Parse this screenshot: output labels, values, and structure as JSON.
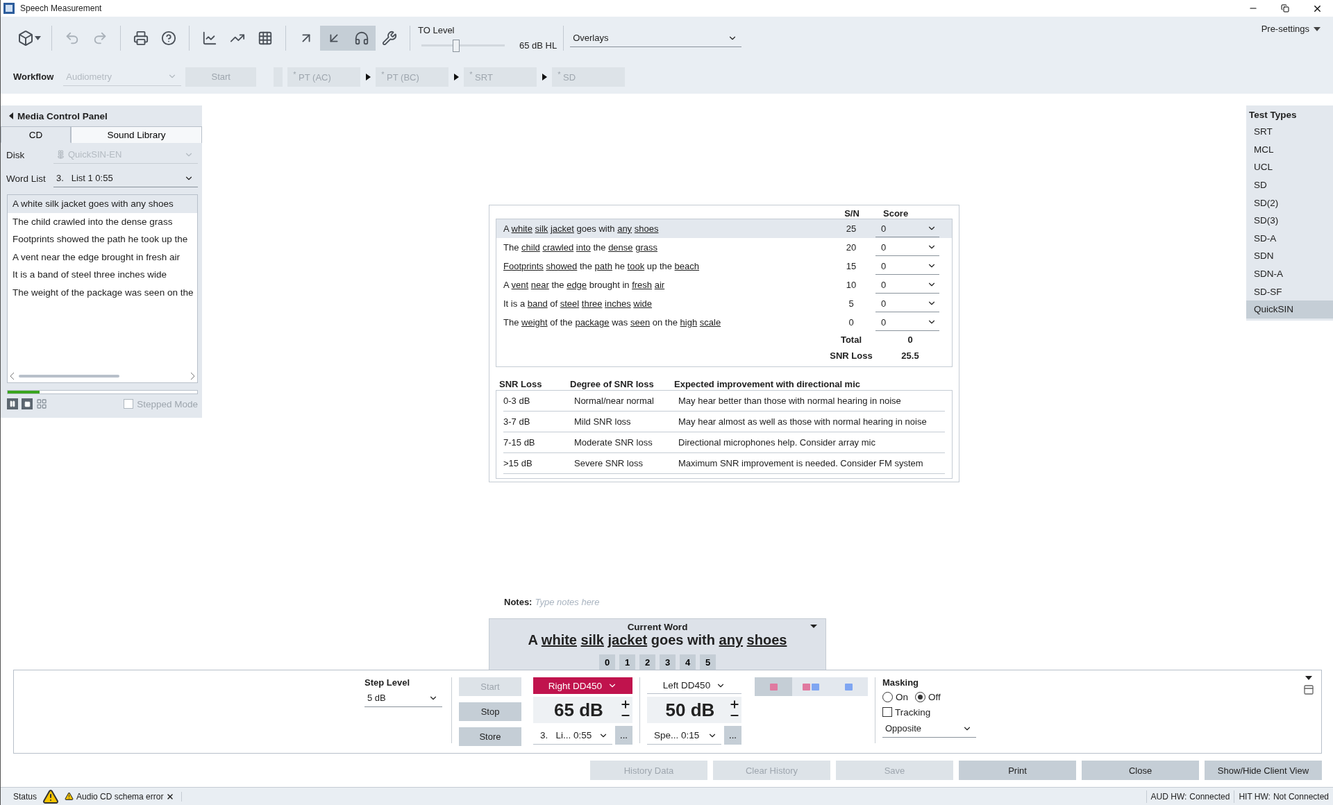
{
  "window": {
    "title": "Speech Measurement"
  },
  "toolbar": {
    "groups": [
      {
        "tools": [
          {
            "kind": "cube_menu",
            "disabled": false,
            "selected": false
          }
        ]
      },
      {
        "tools": [
          {
            "kind": "undo",
            "disabled": true,
            "selected": false
          },
          {
            "kind": "redo",
            "disabled": true,
            "selected": false
          }
        ]
      },
      {
        "tools": [
          {
            "kind": "print",
            "disabled": false,
            "selected": false
          },
          {
            "kind": "help",
            "disabled": false,
            "selected": false
          }
        ]
      },
      {
        "tools": [
          {
            "kind": "audiogram",
            "disabled": false,
            "selected": false
          },
          {
            "kind": "overlay_chart",
            "disabled": false,
            "selected": false
          },
          {
            "kind": "grid_chart",
            "disabled": false,
            "selected": false
          }
        ]
      },
      {
        "tools": [
          {
            "kind": "arrow_out",
            "disabled": false,
            "selected": false
          },
          {
            "kind": "arrow_in",
            "disabled": false,
            "selected": true
          },
          {
            "kind": "headphones",
            "disabled": false,
            "selected": true
          },
          {
            "kind": "wrench",
            "disabled": false,
            "selected": false
          }
        ]
      }
    ],
    "to_level": {
      "label": "TO Level",
      "level": 0.42,
      "reading": "65 dB HL"
    },
    "overlays": {
      "value": "Overlays"
    },
    "presettings": "Pre-settings"
  },
  "workflow": {
    "label": "Workflow",
    "dropdown": {
      "value": "Audiometry",
      "disabled": true
    },
    "start": {
      "label": "Start",
      "disabled": true
    },
    "steps": [
      {
        "label": "$^{*}$ PT (AC)"
      },
      {
        "label": "$^{*}$ PT (BC)"
      },
      {
        "label": "$^{*}$ SRT"
      },
      {
        "label": "$^{*}$ SD"
      }
    ]
  },
  "media_panel": {
    "title": "Media Control Panel",
    "tabs": [
      {
        "label": "CD",
        "selected": true
      },
      {
        "label": "Sound Library",
        "selected": false
      }
    ],
    "disk": {
      "label": "Disk",
      "value": "QuickSIN-EN",
      "disabled": true
    },
    "word_list": {
      "label": "Word List",
      "value": "3.   List 1 0:55"
    },
    "items": [
      {
        "text": "A white silk jacket goes with any shoes",
        "selected": true
      },
      {
        "text": "The child crawled into the dense grass",
        "selected": false
      },
      {
        "text": "Footprints showed the path he took up the",
        "selected": false
      },
      {
        "text": "A vent near the edge brought in fresh air",
        "selected": false
      },
      {
        "text": "It is a band of steel three inches wide",
        "selected": false
      },
      {
        "text": "The weight of the package was seen on the",
        "selected": false
      }
    ],
    "progress": {
      "level": 0.17
    },
    "stepped_mode": {
      "label": "Stepped Mode",
      "checked": false,
      "disabled": true
    }
  },
  "results": {
    "columns": [
      "S/N",
      "Score"
    ],
    "rows": [
      {
        "selected": true,
        "sn": "25",
        "score": "0",
        "words": [
          {
            "word": "A",
            "underlined": false
          },
          {
            "word": "white",
            "underlined": true
          },
          {
            "word": "silk",
            "underlined": true
          },
          {
            "word": "jacket",
            "underlined": true
          },
          {
            "word": "goes",
            "underlined": false
          },
          {
            "word": "with",
            "underlined": false
          },
          {
            "word": "any",
            "underlined": true
          },
          {
            "word": "shoes",
            "underlined": true
          }
        ]
      },
      {
        "selected": false,
        "sn": "20",
        "score": "0",
        "words": [
          {
            "word": "The",
            "underlined": false
          },
          {
            "word": "child",
            "underlined": true
          },
          {
            "word": "crawled",
            "underlined": true
          },
          {
            "word": "into",
            "underlined": true
          },
          {
            "word": "the",
            "underlined": false
          },
          {
            "word": "dense",
            "underlined": true
          },
          {
            "word": "grass",
            "underlined": true
          }
        ]
      },
      {
        "selected": false,
        "sn": "15",
        "score": "0",
        "words": [
          {
            "word": "Footprints",
            "underlined": true
          },
          {
            "word": "showed",
            "underlined": true
          },
          {
            "word": "the",
            "underlined": false
          },
          {
            "word": "path",
            "underlined": true
          },
          {
            "word": "he",
            "underlined": false
          },
          {
            "word": "took",
            "underlined": true
          },
          {
            "word": "up",
            "underlined": false
          },
          {
            "word": "the",
            "underlined": false
          },
          {
            "word": "beach",
            "underlined": true
          }
        ]
      },
      {
        "selected": false,
        "sn": "10",
        "score": "0",
        "words": [
          {
            "word": "A",
            "underlined": false
          },
          {
            "word": "vent",
            "underlined": true
          },
          {
            "word": "near",
            "underlined": true
          },
          {
            "word": "the",
            "underlined": false
          },
          {
            "word": "edge",
            "underlined": true
          },
          {
            "word": "brought",
            "underlined": false
          },
          {
            "word": "in",
            "underlined": false
          },
          {
            "word": "fresh",
            "underlined": true
          },
          {
            "word": "air",
            "underlined": true
          }
        ]
      },
      {
        "selected": false,
        "sn": "5",
        "score": "0",
        "words": [
          {
            "word": "It",
            "underlined": false
          },
          {
            "word": "is",
            "underlined": false
          },
          {
            "word": "a",
            "underlined": false
          },
          {
            "word": "band",
            "underlined": true
          },
          {
            "word": "of",
            "underlined": false
          },
          {
            "word": "steel",
            "underlined": true
          },
          {
            "word": "three",
            "underlined": true
          },
          {
            "word": "inches",
            "underlined": true
          },
          {
            "word": "wide",
            "underlined": true
          }
        ]
      },
      {
        "selected": false,
        "sn": "0",
        "score": "0",
        "words": [
          {
            "word": "The",
            "underlined": false
          },
          {
            "word": "weight",
            "underlined": true
          },
          {
            "word": "of",
            "underlined": false
          },
          {
            "word": "the",
            "underlined": false
          },
          {
            "word": "package",
            "underlined": true
          },
          {
            "word": "was",
            "underlined": false
          },
          {
            "word": "seen",
            "underlined": true
          },
          {
            "word": "on",
            "underlined": false
          },
          {
            "word": "the",
            "underlined": false
          },
          {
            "word": "high",
            "underlined": true
          },
          {
            "word": "scale",
            "underlined": true
          }
        ]
      }
    ],
    "total": {
      "label": "Total",
      "value": "0"
    },
    "snr_loss": {
      "label": "SNR Loss",
      "value": "25.5"
    }
  },
  "snr_table": {
    "columns": [
      "SNR Loss",
      "Degree of SNR loss",
      "Expected improvement with directional mic"
    ],
    "rows": [
      [
        "0-3 dB",
        "Normal/near normal",
        "May hear better than those with normal hearing in noise"
      ],
      [
        "3-7 dB",
        "Mild SNR loss",
        "May hear almost as well as those with normal hearing in noise"
      ],
      [
        "7-15 dB",
        "Moderate SNR loss",
        "Directional microphones help. Consider array mic"
      ],
      [
        ">15 dB",
        "Severe SNR loss",
        "Maximum SNR improvement is needed. Consider FM system"
      ]
    ]
  },
  "notes": {
    "label": "Notes:",
    "placeholder": "Type notes here"
  },
  "current_word": {
    "title": "Current Word",
    "words": [
      {
        "word": "A",
        "underlined": false
      },
      {
        "word": "white",
        "underlined": true
      },
      {
        "word": "silk",
        "underlined": true
      },
      {
        "word": "jacket",
        "underlined": true
      },
      {
        "word": "goes",
        "underlined": false
      },
      {
        "word": "with",
        "underlined": false
      },
      {
        "word": "any",
        "underlined": true
      },
      {
        "word": "shoes",
        "underlined": true
      }
    ],
    "scores": [
      "0",
      "1",
      "2",
      "3",
      "4",
      "5"
    ]
  },
  "test_types": {
    "title": "Test Types",
    "items": [
      {
        "label": "SRT",
        "selected": false
      },
      {
        "label": "MCL",
        "selected": false
      },
      {
        "label": "UCL",
        "selected": false
      },
      {
        "label": "SD",
        "selected": false
      },
      {
        "label": "SD(2)",
        "selected": false
      },
      {
        "label": "SD(3)",
        "selected": false
      },
      {
        "label": "SD-A",
        "selected": false
      },
      {
        "label": "SDN",
        "selected": false
      },
      {
        "label": "SDN-A",
        "selected": false
      },
      {
        "label": "SD-SF",
        "selected": false
      },
      {
        "label": "QuickSIN",
        "selected": true
      }
    ]
  },
  "controls": {
    "step_level": {
      "label": "Step Level",
      "value": "5 dB"
    },
    "actions": [
      {
        "label": "Start",
        "disabled": true
      },
      {
        "label": "Stop",
        "disabled": false
      },
      {
        "label": "Store",
        "disabled": false
      }
    ],
    "channels": [
      {
        "kind": "right",
        "transducer": "Right DD450",
        "level_text": "65 dB",
        "list": "3.   Li... 0:55",
        "more": "..."
      },
      {
        "kind": "left",
        "transducer": "Left DD450",
        "level_text": "50 dB",
        "list": "Spe... 0:15",
        "more": "..."
      }
    ],
    "routing": [
      {
        "kind": "right",
        "selected": true
      },
      {
        "kind": "both",
        "selected": false
      },
      {
        "kind": "left",
        "selected": false
      }
    ],
    "masking": {
      "label": "Masking",
      "options": [
        {
          "label": "On",
          "selected": false
        },
        {
          "label": "Off",
          "selected": true
        }
      ],
      "tracking": {
        "label": "Tracking",
        "checked": false
      },
      "mode": "Opposite"
    }
  },
  "buttons": [
    {
      "label": "History Data",
      "disabled": true
    },
    {
      "label": "Clear History",
      "disabled": true
    },
    {
      "label": "Save",
      "disabled": true
    },
    {
      "label": "Print",
      "disabled": false
    },
    {
      "label": "Close",
      "disabled": false
    },
    {
      "label": "Show/Hide Client View",
      "disabled": false
    }
  ],
  "status_bar": {
    "label": "Status",
    "message": "Audio CD schema error",
    "hardware": [
      {
        "label": "AUD HW:",
        "value": "Connected"
      },
      {
        "label": "HIT HW:",
        "value": "Not Connected"
      }
    ]
  }
}
